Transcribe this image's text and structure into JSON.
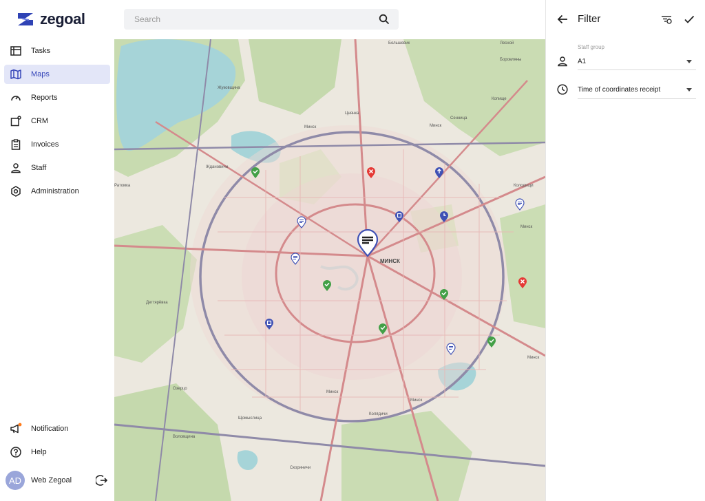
{
  "app": {
    "logo_text": "zegoal",
    "brand_color": "#3545b8"
  },
  "sidebar": {
    "items": [
      {
        "label": "Tasks",
        "icon": "tasks-icon"
      },
      {
        "label": "Maps",
        "icon": "map-icon",
        "active": true
      },
      {
        "label": "Reports",
        "icon": "gauge-icon"
      },
      {
        "label": "CRM",
        "icon": "crm-icon"
      },
      {
        "label": "Invoices",
        "icon": "clipboard-icon"
      },
      {
        "label": "Staff",
        "icon": "person-icon"
      },
      {
        "label": "Administration",
        "icon": "gear-icon"
      }
    ],
    "bottom": [
      {
        "label": "Notification",
        "icon": "megaphone-icon",
        "has_badge": true
      },
      {
        "label": "Help",
        "icon": "help-icon"
      }
    ],
    "user": {
      "initials": "AD",
      "name": "Web Zegoal"
    }
  },
  "search": {
    "placeholder": "Search"
  },
  "map": {
    "labels": {
      "minsk": "МИНСК",
      "zhdanovichi": "Ждановичи",
      "borovlyany": "Боровляны",
      "lesnoy": "Лесной",
      "degtyarevka": "Дегтярёвка",
      "kolodishchi": "Колодищи",
      "ratomka": "Ратомка",
      "ozertso": "Озерцо",
      "kolyadichi": "Колядичи",
      "volovshchina": "Воловщина",
      "skorinichi": "Скориничи",
      "minsk_road_1": "Минск",
      "minsk_road_2": "Минск",
      "minsk_road_3": "Минск",
      "minsk_road_4": "Минск",
      "minsk_road_5": "Минск",
      "minsk_road_6": "Минск",
      "shchomyslitsa": "Щомыслица",
      "zhukovschina": "Жуковщина",
      "kopishche": "Копище",
      "tsnyanka": "Цнянка",
      "bolshevik": "Большевик",
      "sennitsa": "Сенница"
    },
    "markers": [
      {
        "type": "done",
        "color": "#43a047"
      },
      {
        "type": "cancelled",
        "color": "#e53935"
      },
      {
        "type": "up",
        "color": "#3f51b5"
      },
      {
        "type": "pending",
        "color": "#3f51b5"
      },
      {
        "type": "message",
        "color": "#3f51b5"
      },
      {
        "type": "schedule",
        "color": "#3f51b5"
      }
    ]
  },
  "filter": {
    "title": "Filter",
    "staff_group_label": "Staff group",
    "staff_group_value": "A1",
    "time_value": "Time of coordinates receipt"
  }
}
